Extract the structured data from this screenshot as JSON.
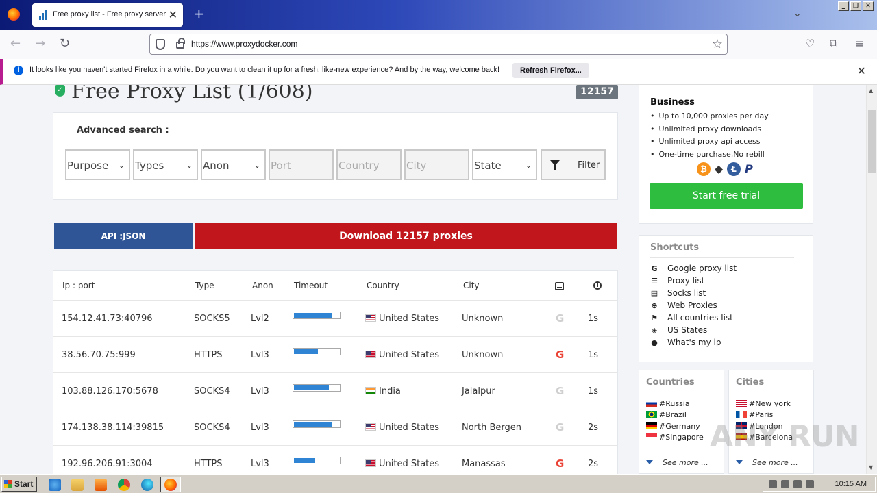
{
  "browser": {
    "tab_title": "Free proxy list - Free proxy server",
    "url": "https://www.proxydocker.com",
    "notification": "It looks like you haven't started Firefox in a while. Do you want to clean it up for a fresh, like-new experience? And by the way, welcome back!",
    "notification_button": "Refresh Firefox..."
  },
  "page": {
    "title": "Free Proxy List (1/608)",
    "count_badge": "12157",
    "search": {
      "heading": "Advanced search :",
      "purpose": "Purpose",
      "types": "Types",
      "anon": "Anon",
      "port_placeholder": "Port",
      "country_placeholder": "Country",
      "city_placeholder": "City",
      "state": "State",
      "filter_label": "Filter"
    },
    "api_button": "API :JSON",
    "download_button": "Download 12157 proxies",
    "table": {
      "headers": [
        "Ip : port",
        "Type",
        "Anon",
        "Timeout",
        "Country",
        "City"
      ],
      "rows": [
        {
          "ip": "154.12.41.73:40796",
          "type": "SOCKS5",
          "anon": "Lvl2",
          "timeout": 0.85,
          "country": "United States",
          "flag": "us",
          "city": "Unknown",
          "google": false,
          "time": "1s"
        },
        {
          "ip": "38.56.70.75:999",
          "type": "HTTPS",
          "anon": "Lvl3",
          "timeout": 0.55,
          "country": "United States",
          "flag": "us",
          "city": "Unknown",
          "google": true,
          "time": "1s"
        },
        {
          "ip": "103.88.126.170:5678",
          "type": "SOCKS4",
          "anon": "Lvl3",
          "timeout": 0.78,
          "country": "India",
          "flag": "in",
          "city": "Jalalpur",
          "google": false,
          "time": "1s"
        },
        {
          "ip": "174.138.38.114:39815",
          "type": "SOCKS4",
          "anon": "Lvl3",
          "timeout": 0.85,
          "country": "United States",
          "flag": "us",
          "city": "North Bergen",
          "google": false,
          "time": "2s"
        },
        {
          "ip": "192.96.206.91:3004",
          "type": "HTTPS",
          "anon": "Lvl3",
          "timeout": 0.48,
          "country": "United States",
          "flag": "us",
          "city": "Manassas",
          "google": true,
          "time": "2s"
        }
      ]
    }
  },
  "sidebar": {
    "business": {
      "title": "Business",
      "features": [
        "Up to 10,000 proxies per day",
        "Unlimited proxy downloads",
        "Unlimited proxy api access",
        "One-time purchase,No rebill"
      ],
      "trial_button": "Start free trial"
    },
    "shortcuts": {
      "title": "Shortcuts",
      "items": [
        "Google proxy list",
        "Proxy list",
        "Socks list",
        "Web Proxies",
        "All countries list",
        "US States",
        "What's my ip"
      ]
    },
    "countries": {
      "title": "Countries",
      "items": [
        "#Russia",
        "#Brazil",
        "#Germany",
        "#Singapore"
      ],
      "see_more": "See more ..."
    },
    "cities": {
      "title": "Cities",
      "items": [
        "#New york",
        "#Paris",
        "#London",
        "#Barcelona"
      ],
      "see_more": "See more ..."
    }
  },
  "watermark": "ANY RUN",
  "taskbar": {
    "start": "Start",
    "clock": "10:15 AM"
  }
}
